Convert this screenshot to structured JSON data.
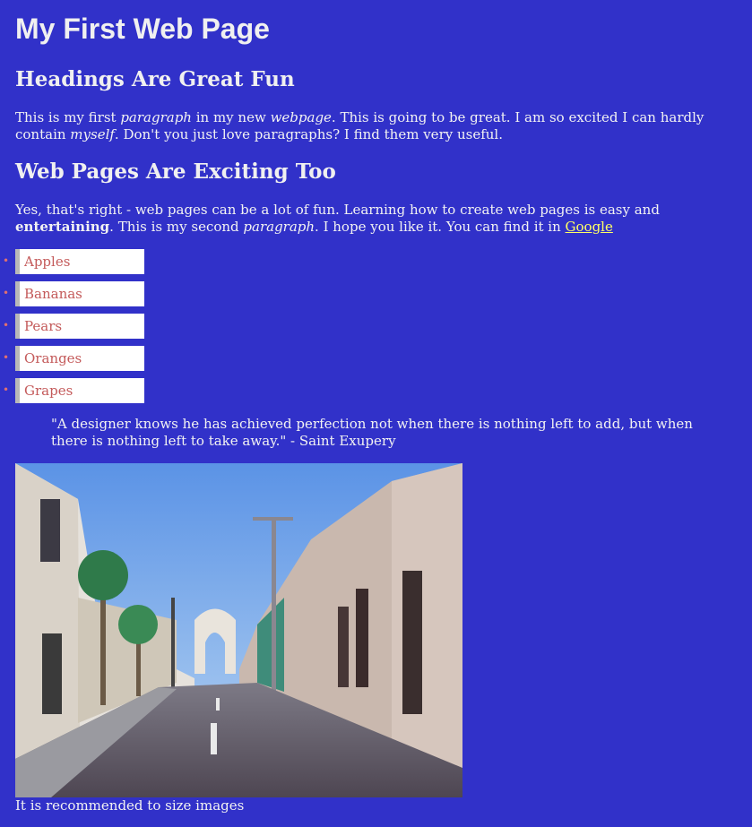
{
  "page": {
    "title": "My First Web Page",
    "heading1": "Headings Are Great Fun",
    "para1": {
      "t1": "This is my first ",
      "em1": "paragraph",
      "t2": " in my new ",
      "em2": "webpage",
      "t3": ". This is going to be great. I am so excited I can hardly contain ",
      "em3": "myself",
      "t4": ". Don't you just love paragraphs? I find them very useful."
    },
    "heading2": "Web Pages Are Exciting Too",
    "para2": {
      "t1": "Yes, that's right - web pages can be a lot of fun. Learning how to create web pages is easy and ",
      "strong1": "entertaining",
      "t2": ". This is my second ",
      "em1": "paragraph",
      "t3": ". I hope you like it. You can find it in ",
      "link": "Google"
    },
    "fruits": [
      "Apples",
      "Bananas",
      "Pears",
      "Oranges",
      "Grapes"
    ],
    "quote": "\"A designer knows he has achieved perfection not when there is nothing left to add, but when there is nothing left to take away.\" - Saint Exupery",
    "caption": "It is recommended to size images"
  },
  "colors": {
    "background": "#3131c9",
    "text": "#f2f2f2",
    "link": "#ffff66",
    "list_text": "#c45a5a",
    "bullet": "#e07070"
  }
}
